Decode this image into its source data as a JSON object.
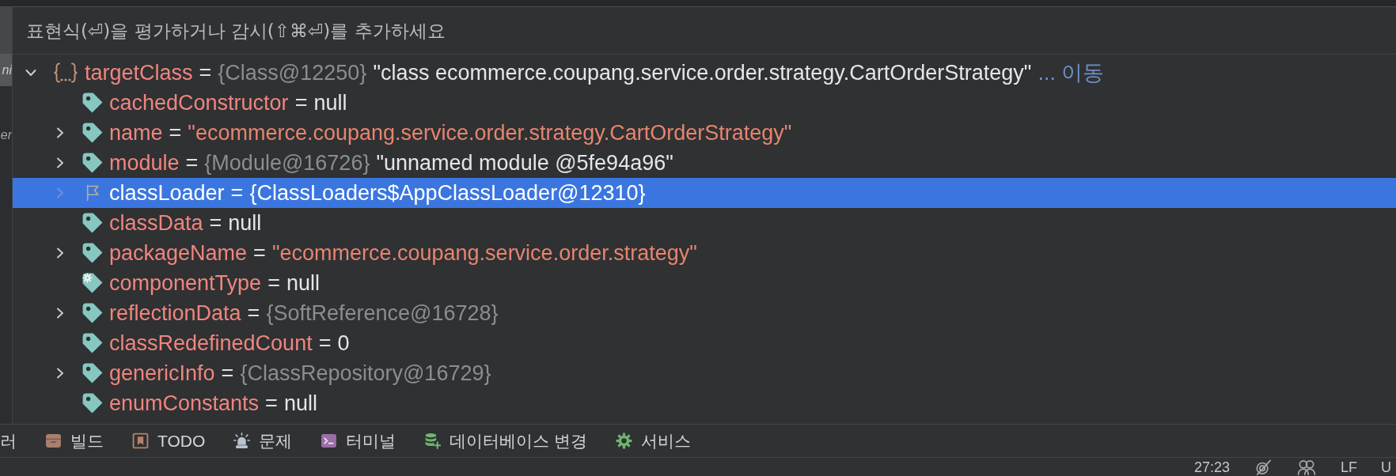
{
  "expression_field": {
    "placeholder": "표현식(⏎)을 평가하거나 감시(⇧⌘⏎)를 추가하세요"
  },
  "frames_panel": {
    "items": [
      {
        "text": "ni",
        "selected": true
      },
      {
        "text": "er",
        "selected": false
      }
    ]
  },
  "variables": [
    {
      "kind": "object",
      "name": "targetClass",
      "separator": "=",
      "expanded": true,
      "selected": false,
      "value": [
        {
          "kind": "reference",
          "text": "{Class@12250}"
        },
        {
          "kind": "plain",
          "text": "\"class ecommerce.coupang.service.order.strategy.CartOrderStrategy\""
        }
      ],
      "link": "... 이동",
      "children": [
        {
          "kind": "field",
          "name": "cachedConstructor",
          "separator": "=",
          "selected": false,
          "value": [
            {
              "kind": "plain",
              "text": "null"
            }
          ]
        },
        {
          "kind": "field",
          "name": "name",
          "separator": "=",
          "expanded": false,
          "selected": false,
          "value": [
            {
              "kind": "string",
              "text": "\"ecommerce.coupang.service.order.strategy.CartOrderStrategy\""
            }
          ]
        },
        {
          "kind": "field",
          "name": "module",
          "separator": "=",
          "expanded": false,
          "selected": false,
          "value": [
            {
              "kind": "reference",
              "text": "{Module@16726}"
            },
            {
              "kind": "plain",
              "text": "\"unnamed module @5fe94a96\""
            }
          ]
        },
        {
          "kind": "marked",
          "name": "classLoader",
          "separator": "=",
          "expanded": false,
          "selected": true,
          "value": [
            {
              "kind": "reference",
              "text": "{ClassLoaders$AppClassLoader@12310}"
            }
          ]
        },
        {
          "kind": "field",
          "name": "classData",
          "separator": "=",
          "selected": false,
          "value": [
            {
              "kind": "plain",
              "text": "null"
            }
          ]
        },
        {
          "kind": "field",
          "name": "packageName",
          "separator": "=",
          "expanded": false,
          "selected": false,
          "value": [
            {
              "kind": "string",
              "text": "\"ecommerce.coupang.service.order.strategy\""
            }
          ]
        },
        {
          "kind": "transient",
          "name": "componentType",
          "separator": "=",
          "selected": false,
          "value": [
            {
              "kind": "plain",
              "text": "null"
            }
          ]
        },
        {
          "kind": "field",
          "name": "reflectionData",
          "separator": "=",
          "expanded": false,
          "selected": false,
          "value": [
            {
              "kind": "reference",
              "text": "{SoftReference@16728}"
            }
          ]
        },
        {
          "kind": "field",
          "name": "classRedefinedCount",
          "separator": "=",
          "selected": false,
          "value": [
            {
              "kind": "plain",
              "text": "0"
            }
          ]
        },
        {
          "kind": "field",
          "name": "genericInfo",
          "separator": "=",
          "expanded": false,
          "selected": false,
          "value": [
            {
              "kind": "reference",
              "text": "{ClassRepository@16729}"
            }
          ]
        },
        {
          "kind": "field",
          "name": "enumConstants",
          "separator": "=",
          "selected": false,
          "value": [
            {
              "kind": "plain",
              "text": "null"
            }
          ]
        }
      ]
    }
  ],
  "tool_window_bar": [
    {
      "kind": "plain",
      "label": "러"
    },
    {
      "kind": "build",
      "label": "빌드"
    },
    {
      "kind": "todo",
      "label": "TODO"
    },
    {
      "kind": "problems",
      "label": "문제"
    },
    {
      "kind": "terminal",
      "label": "터미널"
    },
    {
      "kind": "database",
      "label": "데이터베이스 변경"
    },
    {
      "kind": "services",
      "label": "서비스"
    }
  ],
  "status_bar": [
    {
      "kind": "text",
      "text": "27:23"
    },
    {
      "kind": "inspections"
    },
    {
      "kind": "collaboration"
    },
    {
      "kind": "text",
      "text": "LF"
    },
    {
      "kind": "text",
      "text": "U"
    }
  ]
}
